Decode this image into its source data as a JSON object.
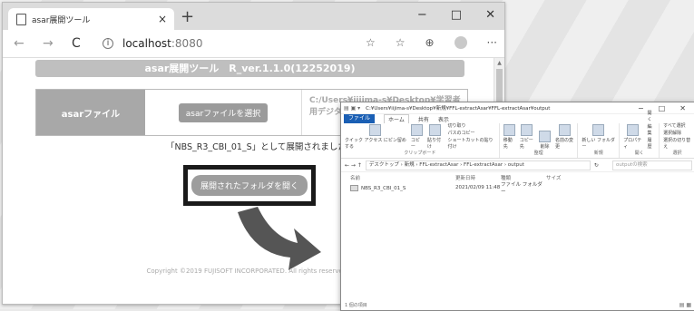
{
  "browser": {
    "tab_title": "asar展開ツール",
    "tab_close": "×",
    "new_tab": "+",
    "win_min": "−",
    "win_max": "□",
    "win_close": "✕",
    "back": "←",
    "forward": "→",
    "reload": "C",
    "info": "i",
    "url_host": "localhost",
    "url_port": ":8080",
    "toolbar_icons": [
      "☆",
      "☆",
      "⊕",
      "",
      "···"
    ]
  },
  "app": {
    "title": "asar展開ツール　R_ver.1.1.0(12252019)",
    "asar_label": "asarファイル",
    "select_button": "asarファイルを選択",
    "path_line1": "C:/Users¥iijima-s¥Desktop¥学習者",
    "path_line2": "用デジタル教科書(各教科)",
    "result_message": "「NBS_R3_CBI_01_S」として展開されました。",
    "open_folder_button": "展開されたフォルダを開く",
    "copyright": "Copyright ©2019 FUJISOFT INCORPORATED. All rights reserved."
  },
  "explorer": {
    "title_path": "C:¥Users¥iijima-s¥Desktop¥新規¥FFL-extractAsar¥FFL-extractAsar¥output",
    "win_min": "−",
    "win_max": "□",
    "win_close": "✕",
    "tabs": [
      "ファイル",
      "ホーム",
      "共有",
      "表示"
    ],
    "ribbon_groups": [
      {
        "name": "クリップボード",
        "items": [
          "クイック アクセス にピン留めする",
          "コピー",
          "貼り付け"
        ],
        "small": [
          "切り取り",
          "パスのコピー",
          "ショートカットの貼り付け"
        ]
      },
      {
        "name": "整理",
        "items": [
          "移動先",
          "コピー先",
          "削除",
          "名前の変更"
        ],
        "small": []
      },
      {
        "name": "新規",
        "items": [
          "新しい フォルダー"
        ],
        "small": []
      },
      {
        "name": "開く",
        "items": [
          "プロパティ"
        ],
        "small": [
          "開く",
          "編集",
          "履歴"
        ]
      },
      {
        "name": "選択",
        "items": [],
        "small": [
          "すべて選択",
          "選択解除",
          "選択の切り替え"
        ]
      }
    ],
    "breadcrumb": "デスクトップ › 新規 › FFL-extractAsar › FFL-extractAsar › output",
    "search_placeholder": "outputの検索",
    "columns": [
      "名前",
      "更新日時",
      "種類",
      "サイズ"
    ],
    "rows": [
      {
        "name": "NBS_R3_CBI_01_S",
        "date": "2021/02/09 11:48",
        "type": "ファイル フォルダー",
        "size": ""
      }
    ],
    "status": "1 個の項目",
    "view_icons": "▤ ▦"
  }
}
